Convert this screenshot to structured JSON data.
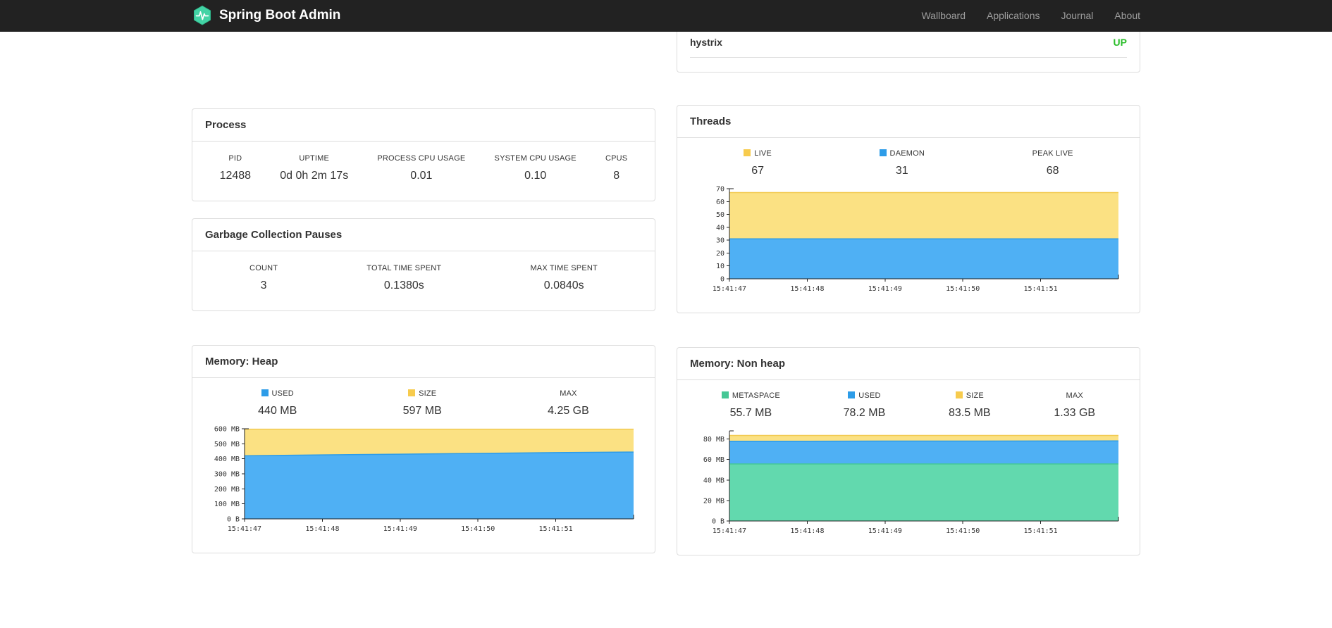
{
  "navbar": {
    "brand": "Spring Boot Admin",
    "items": [
      {
        "label": "Wallboard"
      },
      {
        "label": "Applications"
      },
      {
        "label": "Journal"
      },
      {
        "label": "About"
      }
    ]
  },
  "colors": {
    "up": "#2DBE2D",
    "brand_green": "#43D3A5",
    "yellow_swatch": "#F7CB4D",
    "blue_swatch": "#2D9CE8",
    "green_swatch": "#45C795"
  },
  "health": {
    "service": "hystrix",
    "status": "UP"
  },
  "process": {
    "title": "Process",
    "metrics": [
      {
        "label": "PID",
        "value": "12488"
      },
      {
        "label": "UPTIME",
        "value": "0d 0h 2m 17s"
      },
      {
        "label": "PROCESS CPU USAGE",
        "value": "0.01"
      },
      {
        "label": "SYSTEM CPU USAGE",
        "value": "0.10"
      },
      {
        "label": "CPUS",
        "value": "8"
      }
    ]
  },
  "gc": {
    "title": "Garbage Collection Pauses",
    "metrics": [
      {
        "label": "COUNT",
        "value": "3"
      },
      {
        "label": "TOTAL TIME SPENT",
        "value": "0.1380s"
      },
      {
        "label": "MAX TIME SPENT",
        "value": "0.0840s"
      }
    ]
  },
  "threads": {
    "title": "Threads",
    "legend": [
      {
        "label": "LIVE",
        "value": "67"
      },
      {
        "label": "DAEMON",
        "value": "31"
      },
      {
        "label": "PEAK LIVE",
        "value": "68"
      }
    ],
    "chart_data": {
      "type": "area",
      "x": [
        "15:41:47",
        "15:41:48",
        "15:41:49",
        "15:41:50",
        "15:41:51"
      ],
      "points": 6,
      "ymax": 70,
      "yticks": [
        {
          "v": 0,
          "label": "0"
        },
        {
          "v": 10,
          "label": "10"
        },
        {
          "v": 20,
          "label": "20"
        },
        {
          "v": 30,
          "label": "30"
        },
        {
          "v": 40,
          "label": "40"
        },
        {
          "v": 50,
          "label": "50"
        },
        {
          "v": 60,
          "label": "60"
        },
        {
          "v": 70,
          "label": "70"
        }
      ],
      "series": [
        {
          "name": "LIVE",
          "fill": "#FBE183",
          "stroke": "#F2CA51",
          "values": [
            67,
            67,
            67,
            67,
            67,
            67
          ]
        },
        {
          "name": "DAEMON",
          "fill": "#4FB0F4",
          "stroke": "#2D9CE8",
          "values": [
            31,
            31,
            31,
            31,
            31,
            31
          ]
        }
      ]
    }
  },
  "heap": {
    "title": "Memory: Heap",
    "legend": [
      {
        "label": "USED",
        "value": "440 MB"
      },
      {
        "label": "SIZE",
        "value": "597 MB"
      },
      {
        "label": "MAX",
        "value": "4.25 GB"
      }
    ],
    "chart_data": {
      "type": "area",
      "x": [
        "15:41:47",
        "15:41:48",
        "15:41:49",
        "15:41:50",
        "15:41:51"
      ],
      "points": 6,
      "ymax": 600,
      "yticks": [
        {
          "v": 0,
          "label": "0 B"
        },
        {
          "v": 100,
          "label": "100 MB"
        },
        {
          "v": 200,
          "label": "200 MB"
        },
        {
          "v": 300,
          "label": "300 MB"
        },
        {
          "v": 400,
          "label": "400 MB"
        },
        {
          "v": 500,
          "label": "500 MB"
        },
        {
          "v": 600,
          "label": "600 MB"
        }
      ],
      "series": [
        {
          "name": "SIZE",
          "fill": "#FBE183",
          "stroke": "#F2CA51",
          "values": [
            597,
            597,
            597,
            597,
            597,
            597
          ]
        },
        {
          "name": "USED",
          "fill": "#4FB0F4",
          "stroke": "#2D9CE8",
          "values": [
            420,
            426,
            431,
            436,
            441,
            445
          ]
        }
      ]
    }
  },
  "nonheap": {
    "title": "Memory: Non heap",
    "legend": [
      {
        "label": "METASPACE",
        "value": "55.7 MB"
      },
      {
        "label": "USED",
        "value": "78.2 MB"
      },
      {
        "label": "SIZE",
        "value": "83.5 MB"
      },
      {
        "label": "MAX",
        "value": "1.33 GB"
      }
    ],
    "chart_data": {
      "type": "area",
      "x": [
        "15:41:47",
        "15:41:48",
        "15:41:49",
        "15:41:50",
        "15:41:51"
      ],
      "points": 6,
      "ymax": 88,
      "yticks": [
        {
          "v": 0,
          "label": "0 B"
        },
        {
          "v": 20,
          "label": "20 MB"
        },
        {
          "v": 40,
          "label": "40 MB"
        },
        {
          "v": 60,
          "label": "60 MB"
        },
        {
          "v": 80,
          "label": "80 MB"
        }
      ],
      "series": [
        {
          "name": "SIZE",
          "fill": "#FBE183",
          "stroke": "#F2CA51",
          "values": [
            83.5,
            83.5,
            83.5,
            83.5,
            83.5,
            83.5
          ]
        },
        {
          "name": "USED",
          "fill": "#4FB0F4",
          "stroke": "#2D9CE8",
          "values": [
            77.8,
            77.9,
            78.0,
            78.0,
            78.1,
            78.2
          ]
        },
        {
          "name": "METASPACE",
          "fill": "#62D9AE",
          "stroke": "#45C795",
          "values": [
            55.7,
            55.7,
            55.7,
            55.7,
            55.7,
            55.7
          ]
        }
      ]
    }
  }
}
